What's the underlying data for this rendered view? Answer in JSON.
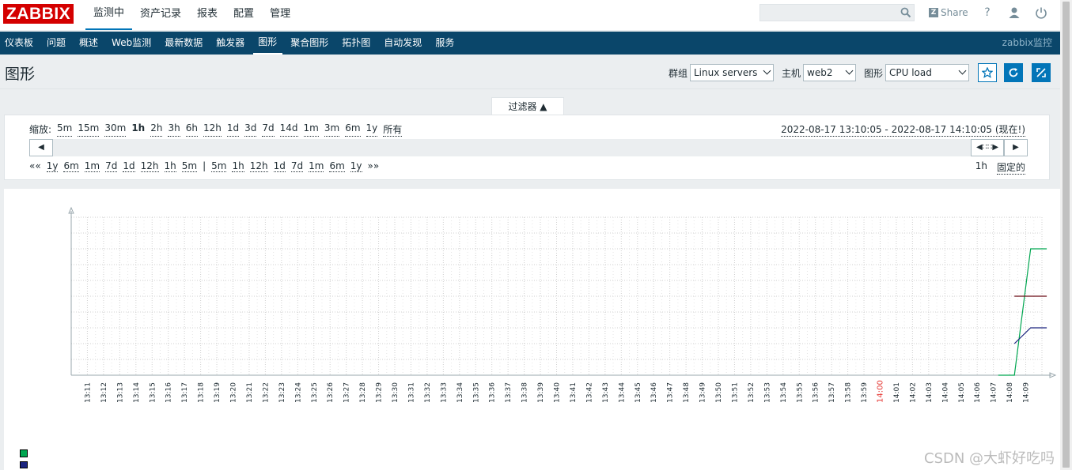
{
  "logo": "ZABBIX",
  "main_nav": [
    "监测中",
    "资产记录",
    "报表",
    "配置",
    "管理"
  ],
  "share_label": "Share",
  "sub_nav": [
    "仪表板",
    "问题",
    "概述",
    "Web监测",
    "最新数据",
    "触发器",
    "图形",
    "聚合图形",
    "拓扑图",
    "自动发现",
    "服务"
  ],
  "brand": "zabbix监控",
  "page_title": "图形",
  "filters": {
    "group_label": "群组",
    "group_value": "Linux servers",
    "host_label": "主机",
    "host_value": "web2",
    "graph_label": "图形",
    "graph_value": "CPU load"
  },
  "filter_tab": "过滤器 ▲",
  "zoom": {
    "label": "缩放:",
    "options": [
      "5m",
      "15m",
      "30m",
      "1h",
      "2h",
      "3h",
      "6h",
      "12h",
      "1d",
      "3d",
      "7d",
      "14d",
      "1m",
      "3m",
      "6m",
      "1y",
      "所有"
    ],
    "current": "1h"
  },
  "range": "2022-08-17 13:10:05 - 2022-08-17 14:10:05 (现在!)",
  "nav_back": [
    "««",
    "1y",
    "6m",
    "1m",
    "7d",
    "1d",
    "12h",
    "1h",
    "5m"
  ],
  "nav_sep": "|",
  "nav_fwd": [
    "5m",
    "1h",
    "12h",
    "1d",
    "7d",
    "1m",
    "6m",
    "1y",
    "»»"
  ],
  "period": "1h",
  "fixed": "固定的",
  "chart_data": {
    "type": "line",
    "x_ticks": [
      "13:11",
      "13:12",
      "13:13",
      "13:14",
      "13:15",
      "13:16",
      "13:17",
      "13:18",
      "13:19",
      "13:20",
      "13:21",
      "13:22",
      "13:23",
      "13:24",
      "13:25",
      "13:26",
      "13:27",
      "13:28",
      "13:29",
      "13:30",
      "13:31",
      "13:32",
      "13:33",
      "13:34",
      "13:35",
      "13:36",
      "13:37",
      "13:38",
      "13:39",
      "13:40",
      "13:41",
      "13:42",
      "13:43",
      "13:44",
      "13:45",
      "13:46",
      "13:47",
      "13:48",
      "13:49",
      "13:50",
      "13:51",
      "13:52",
      "13:53",
      "13:54",
      "13:55",
      "13:56",
      "13:57",
      "13:58",
      "13:59",
      "14:00",
      "14:01",
      "14:02",
      "14:03",
      "14:04",
      "14:05",
      "14:06",
      "14:07",
      "14:08",
      "14:09"
    ],
    "highlight_tick": "14:00",
    "grid": true,
    "series": [
      {
        "color": "#00a650",
        "points": [
          [
            57.3,
            0
          ],
          [
            58.3,
            0
          ],
          [
            59.3,
            0.8
          ],
          [
            60.3,
            0.8
          ]
        ]
      },
      {
        "color": "#1a237e",
        "points": [
          [
            58.3,
            0.2
          ],
          [
            59.3,
            0.3
          ],
          [
            60.3,
            0.3
          ]
        ]
      },
      {
        "color": "#6b0a14",
        "points": [
          [
            58.3,
            0.5
          ],
          [
            60.3,
            0.5
          ]
        ]
      }
    ],
    "legend_colors": [
      "#00a650",
      "#1a237e"
    ]
  },
  "watermark": "CSDN @大虾好吃吗"
}
